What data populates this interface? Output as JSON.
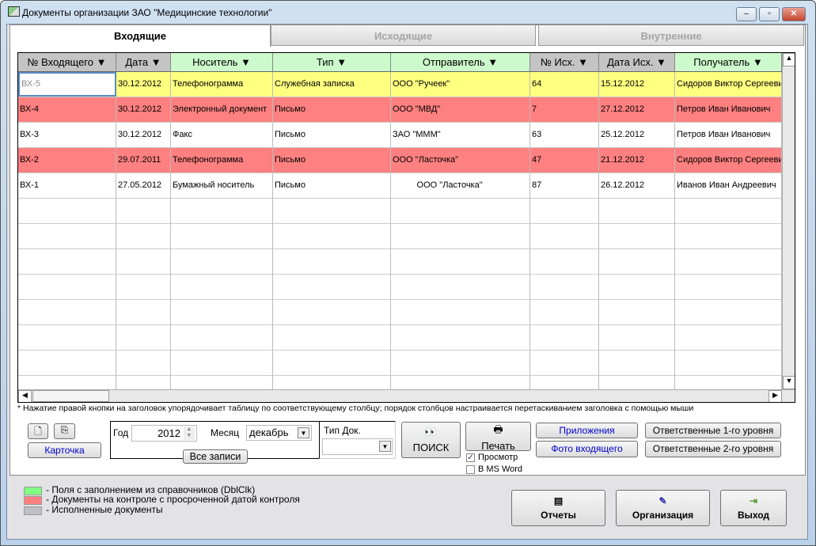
{
  "window": {
    "title": "Документы организации ЗАО \"Медицинские технологии\"",
    "minimize": "–",
    "maximize": "▫",
    "close": "✕"
  },
  "tabs": [
    {
      "label": "Входящие",
      "active": true
    },
    {
      "label": "Исходящие",
      "active": false
    },
    {
      "label": "Внутренние",
      "active": false
    }
  ],
  "grid": {
    "columns": [
      {
        "label": "№ Входящего ▼",
        "kind": "gray"
      },
      {
        "label": "Дата ▼",
        "kind": "gray"
      },
      {
        "label": "Носитель ▼",
        "kind": "green"
      },
      {
        "label": "Тип ▼",
        "kind": "green"
      },
      {
        "label": "Отправитель ▼",
        "kind": "green"
      },
      {
        "label": "№ Исх. ▼",
        "kind": "gray"
      },
      {
        "label": "Дата Исх. ▼",
        "kind": "gray"
      },
      {
        "label": "Получатель ▼",
        "kind": "green"
      }
    ],
    "rows": [
      {
        "status": "selected",
        "cells": [
          "ВХ-5",
          "30.12.2012",
          "Телефонограмма",
          "Служебная записка",
          "ООО \"Ручеек\"",
          "64",
          "15.12.2012",
          "Сидоров Виктор Сергеевич"
        ]
      },
      {
        "status": "overdue",
        "cells": [
          "ВХ-4",
          "30.12.2012",
          "Электронный документ",
          "Письмо",
          "ООО \"МВД\"",
          "7",
          "27.12.2012",
          "Петров Иван Иванович"
        ]
      },
      {
        "status": "normal",
        "cells": [
          "ВХ-3",
          "30.12.2012",
          "Факс",
          "Письмо",
          "ЗАО \"МММ\"",
          "63",
          "25.12.2012",
          "Петров Иван Иванович"
        ]
      },
      {
        "status": "overdue",
        "cells": [
          "ВХ-2",
          "29.07.2011",
          "Телефонограмма",
          "Письмо",
          "ООО \"Ласточка\"",
          "47",
          "21.12.2012",
          "Сидоров Виктор Сергеевич"
        ]
      },
      {
        "status": "normal",
        "cells": [
          "ВХ-1",
          "27.05.2012",
          "Бумажный носитель",
          "Письмо",
          "          ООО \"Ласточка\"",
          "87",
          "26.12.2012",
          "Иванов Иван Андреевич"
        ]
      }
    ]
  },
  "hint": "* Нажатие правой кнопки на заголовок упорядочивает таблицу по соответствующему  столбцу;  порядок столбцов настраивается перетаскиванием заголовка с помощью мыши",
  "controls": {
    "card": "Карточка",
    "year_label": "Год",
    "year": "2012",
    "month_label": "Месяц",
    "month": "декабрь",
    "all_records": "Все записи",
    "doc_type_label": "Тип Док.",
    "doc_type": "",
    "search": "ПОИСК",
    "print": "Печать",
    "preview": "Просмотр",
    "preview_checked": true,
    "msword": "В MS Word",
    "msword_checked": false,
    "attachments": "Приложения",
    "photo": "Фото входящего",
    "resp1": "Ответственные 1-го уровня",
    "resp2": "Ответственные 2-го уровня"
  },
  "legend": [
    {
      "color": "#80ff80",
      "text": "- Поля с заполнением из справочников (DblClk)"
    },
    {
      "color": "#ff8080",
      "text": "- Документы на контроле с просроченной датой контроля"
    },
    {
      "color": "#c0c0c8",
      "text": "- Исполненные документы"
    }
  ],
  "footer": {
    "reports": "Отчеты",
    "org": "Организация",
    "exit": "Выход"
  },
  "colors": {
    "selected": "#ffff80",
    "overdue": "#ff8080",
    "normal": "#ffffff",
    "header_gray": "#c4c4c4",
    "header_green": "#ccfacc"
  }
}
